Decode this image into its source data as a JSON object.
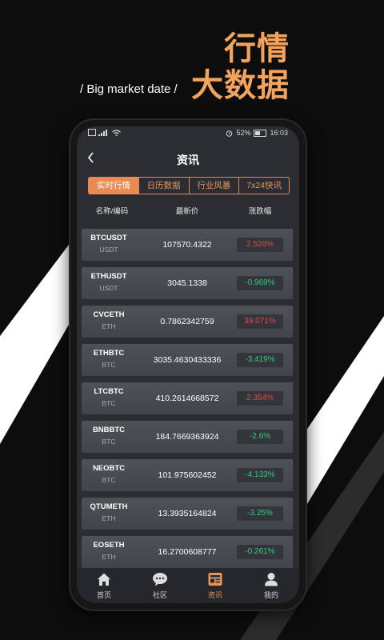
{
  "promo": {
    "headline_1": "行情",
    "headline_2": "大数据",
    "subtitle": "/ Big market date /"
  },
  "status_bar": {
    "battery": "52%",
    "time": "16:03"
  },
  "nav": {
    "title": "资讯",
    "back_icon": "chevron-left-icon"
  },
  "tabs": [
    {
      "label": "实时行情",
      "active": true
    },
    {
      "label": "日历数据",
      "active": false
    },
    {
      "label": "行业风暴",
      "active": false
    },
    {
      "label": "7x24快讯",
      "active": false
    }
  ],
  "columns": {
    "name": "名称/编码",
    "price": "最新价",
    "change": "涨跌幅"
  },
  "rows": [
    {
      "pair": "BTCUSDT",
      "quote": "USDT",
      "price": "107570.4322",
      "change": "2.526%",
      "direction": "up"
    },
    {
      "pair": "ETHUSDT",
      "quote": "USDT",
      "price": "3045.1338",
      "change": "-0.969%",
      "direction": "down"
    },
    {
      "pair": "CVCETH",
      "quote": "ETH",
      "price": "0.7862342759",
      "change": "39.071%",
      "direction": "up"
    },
    {
      "pair": "ETHBTC",
      "quote": "BTC",
      "price": "3035.4630433336",
      "change": "-3.419%",
      "direction": "down"
    },
    {
      "pair": "LTCBTC",
      "quote": "BTC",
      "price": "410.2614668572",
      "change": "2.354%",
      "direction": "up"
    },
    {
      "pair": "BNBBTC",
      "quote": "BTC",
      "price": "184.7669363924",
      "change": "-2.6%",
      "direction": "down"
    },
    {
      "pair": "NEOBTC",
      "quote": "BTC",
      "price": "101.975602452",
      "change": "-4.133%",
      "direction": "down"
    },
    {
      "pair": "QTUMETH",
      "quote": "ETH",
      "price": "13.3935164824",
      "change": "-3.25%",
      "direction": "down"
    },
    {
      "pair": "EOSETH",
      "quote": "ETH",
      "price": "16.2700608777",
      "change": "-0.261%",
      "direction": "down"
    }
  ],
  "bottom_nav": [
    {
      "label": "首页",
      "icon": "home-icon",
      "active": false
    },
    {
      "label": "社区",
      "icon": "chat-bubble-icon",
      "active": false
    },
    {
      "label": "资讯",
      "icon": "news-icon",
      "active": true
    },
    {
      "label": "我的",
      "icon": "user-icon",
      "active": false
    }
  ],
  "colors": {
    "accent": "#ea8a52",
    "up": "#e34a4a",
    "down": "#35c97a",
    "background": "#0d0d0d"
  }
}
